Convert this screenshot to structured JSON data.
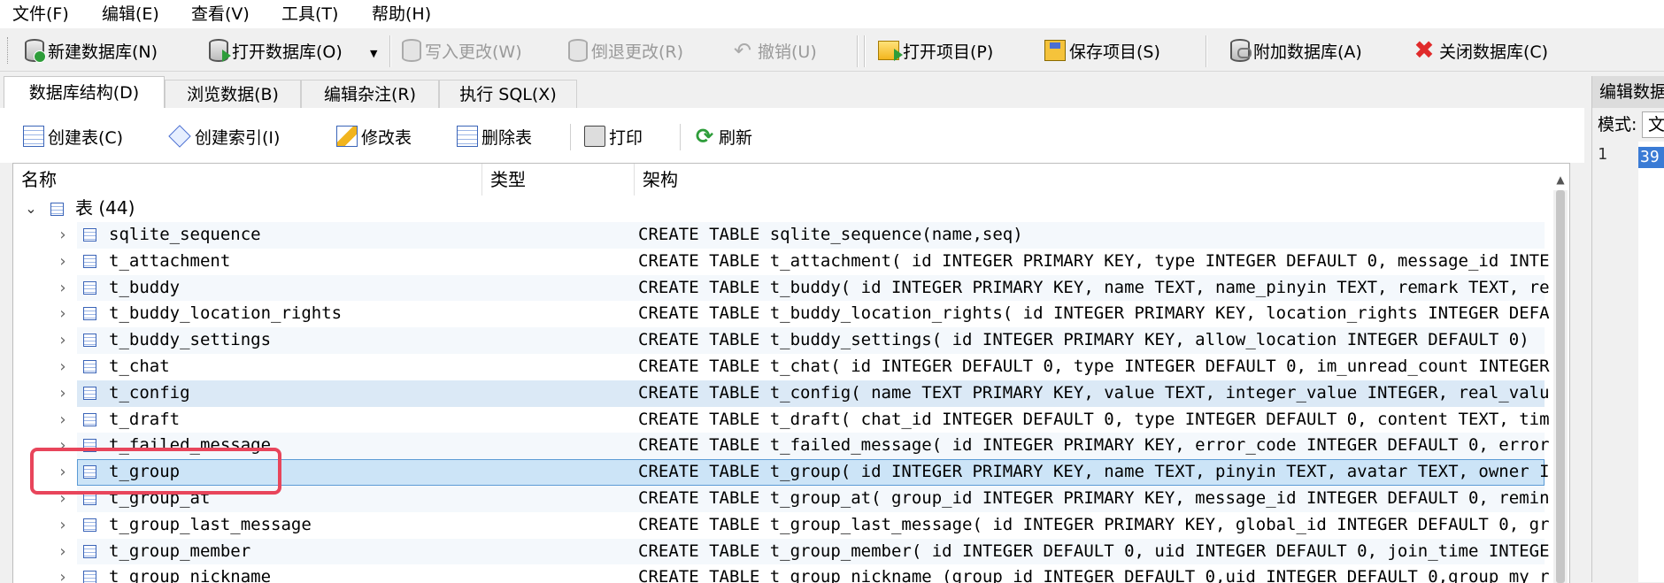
{
  "menu": [
    {
      "label": "文件(F)"
    },
    {
      "label": "编辑(E)"
    },
    {
      "label": "查看(V)"
    },
    {
      "label": "工具(T)"
    },
    {
      "label": "帮助(H)"
    }
  ],
  "toolbar": {
    "new_db": "新建数据库(N)",
    "open_db": "打开数据库(O)",
    "write_changes": "写入更改(W)",
    "revert_changes": "倒退更改(R)",
    "undo": "撤销(U)",
    "open_project": "打开项目(P)",
    "save_project": "保存项目(S)",
    "attach_db": "附加数据库(A)",
    "close_db": "关闭数据库(C)"
  },
  "tabs": [
    {
      "label": "数据库结构(D)",
      "active": true
    },
    {
      "label": "浏览数据(B)",
      "active": false
    },
    {
      "label": "编辑杂注(R)",
      "active": false
    },
    {
      "label": "执行 SQL(X)",
      "active": false
    }
  ],
  "subtoolbar": {
    "create_table": "创建表(C)",
    "create_index": "创建索引(I)",
    "modify_table": "修改表",
    "delete_table": "删除表",
    "print": "打印",
    "refresh": "刷新"
  },
  "grid": {
    "columns": {
      "name": "名称",
      "type": "类型",
      "schema": "架构"
    },
    "group_label": "表 (44)",
    "rows": [
      {
        "name": "sqlite_sequence",
        "schema": "CREATE TABLE sqlite_sequence(name,seq)"
      },
      {
        "name": "t_attachment",
        "schema": "CREATE TABLE t_attachment( id INTEGER PRIMARY KEY, type INTEGER DEFAULT 0, message_id INTE"
      },
      {
        "name": "t_buddy",
        "schema": "CREATE TABLE t_buddy( id INTEGER PRIMARY KEY, name TEXT, name_pinyin TEXT, remark TEXT, re"
      },
      {
        "name": "t_buddy_location_rights",
        "schema": "CREATE TABLE t_buddy_location_rights( id INTEGER PRIMARY KEY, location_rights INTEGER DEFA"
      },
      {
        "name": "t_buddy_settings",
        "schema": "CREATE TABLE t_buddy_settings( id INTEGER PRIMARY KEY, allow_location INTEGER DEFAULT 0)"
      },
      {
        "name": "t_chat",
        "schema": "CREATE TABLE t_chat( id INTEGER DEFAULT 0, type INTEGER DEFAULT 0, im_unread_count INTEGER"
      },
      {
        "name": "t_config",
        "schema": "CREATE TABLE t_config( name TEXT PRIMARY KEY, value TEXT, integer_value INTEGER, real_valu"
      },
      {
        "name": "t_draft",
        "schema": "CREATE TABLE t_draft( chat_id INTEGER DEFAULT 0, type INTEGER DEFAULT 0, content TEXT, tim"
      },
      {
        "name": "t_failed_message",
        "schema": "CREATE TABLE t_failed_message( id INTEGER PRIMARY KEY, error_code INTEGER DEFAULT 0, error"
      },
      {
        "name": "t_group",
        "schema": "CREATE TABLE t_group( id INTEGER PRIMARY KEY, name TEXT, pinyin TEXT, avatar TEXT, owner I"
      },
      {
        "name": "t_group_at",
        "schema": "CREATE TABLE t_group_at( group_id INTEGER PRIMARY KEY, message_id INTEGER DEFAULT 0, remin"
      },
      {
        "name": "t_group_last_message",
        "schema": "CREATE TABLE t_group_last_message( id INTEGER PRIMARY KEY, global_id INTEGER DEFAULT 0, gr"
      },
      {
        "name": "t_group_member",
        "schema": "CREATE TABLE t_group_member( id INTEGER DEFAULT 0, uid INTEGER DEFAULT 0, join_time INTEGE"
      },
      {
        "name": "t_group_nickname",
        "schema": "CREATE TABLE t_group_nickname (group_id INTEGER DEFAULT 0,uid INTEGER DEFAULT 0,group_my_r"
      }
    ]
  },
  "right_panel": {
    "title": "编辑数据",
    "mode_label": "模式:",
    "mode_value": "文",
    "line_number": "1",
    "value": "39"
  }
}
